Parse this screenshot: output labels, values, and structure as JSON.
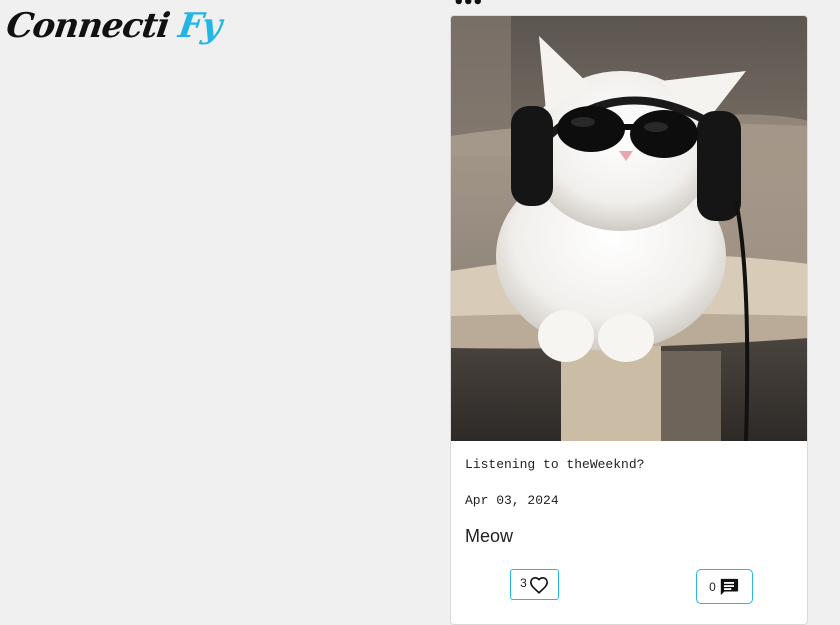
{
  "brand": {
    "part1": "Connecti",
    "part2": "Fy"
  },
  "menu": {
    "icon": "more-horizontal-icon",
    "glyph": "•••"
  },
  "post": {
    "image_desc": "cat-with-sunglasses-and-headphones-photo",
    "caption": "Listening to theWeeknd?",
    "date": "Apr 03, 2024",
    "title": "Meow",
    "likes": "3",
    "comments": "0"
  },
  "colors": {
    "accent": "#22b5e6",
    "button_border": "#29b7e0",
    "background": "#f0f0f0"
  }
}
